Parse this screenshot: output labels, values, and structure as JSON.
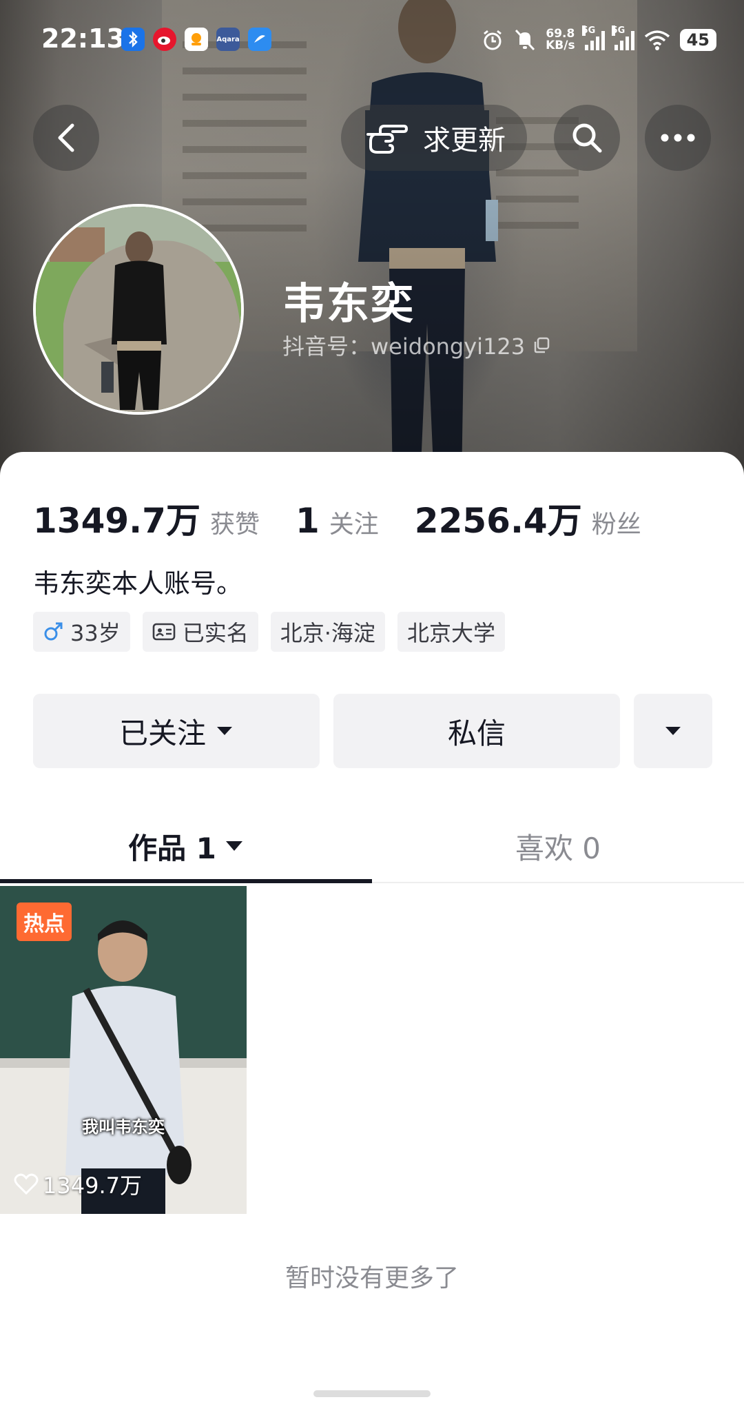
{
  "status_bar": {
    "time": "22:13",
    "app_icons": [
      "bluetooth-icon",
      "weibo-icon",
      "app-icon",
      "aqara-icon",
      "app-icon"
    ],
    "aqara_label": "Aqara",
    "net_speed_value": "69.8",
    "net_speed_unit": "KB/s",
    "signal1_label": "5G",
    "signal2_label": "5G",
    "battery": "45"
  },
  "header": {
    "update_label": "求更新",
    "name": "韦东奕",
    "uid_text": "抖音号：weidongyi123"
  },
  "stats": {
    "likes_num": "1349.7万",
    "likes_label": "获赞",
    "following_num": "1",
    "following_label": "关注",
    "fans_num": "2256.4万",
    "fans_label": "粉丝"
  },
  "bio": "韦东奕本人账号。",
  "tags": {
    "age": "33岁",
    "verified": "已实名",
    "location": "北京·海淀",
    "school": "北京大学"
  },
  "actions": {
    "followed": "已关注",
    "message": "私信"
  },
  "tabs": {
    "works": "作品 1",
    "likes": "喜欢 0"
  },
  "video": {
    "badge": "热点",
    "caption": "我叫韦东奕",
    "likes": "1349.7万"
  },
  "footer": {
    "no_more": "暂时没有更多了"
  },
  "colors": {
    "hot_badge": "#fe6a32",
    "text_primary": "#161823",
    "text_secondary": "#8a8b91",
    "button_bg": "#f2f2f4"
  }
}
